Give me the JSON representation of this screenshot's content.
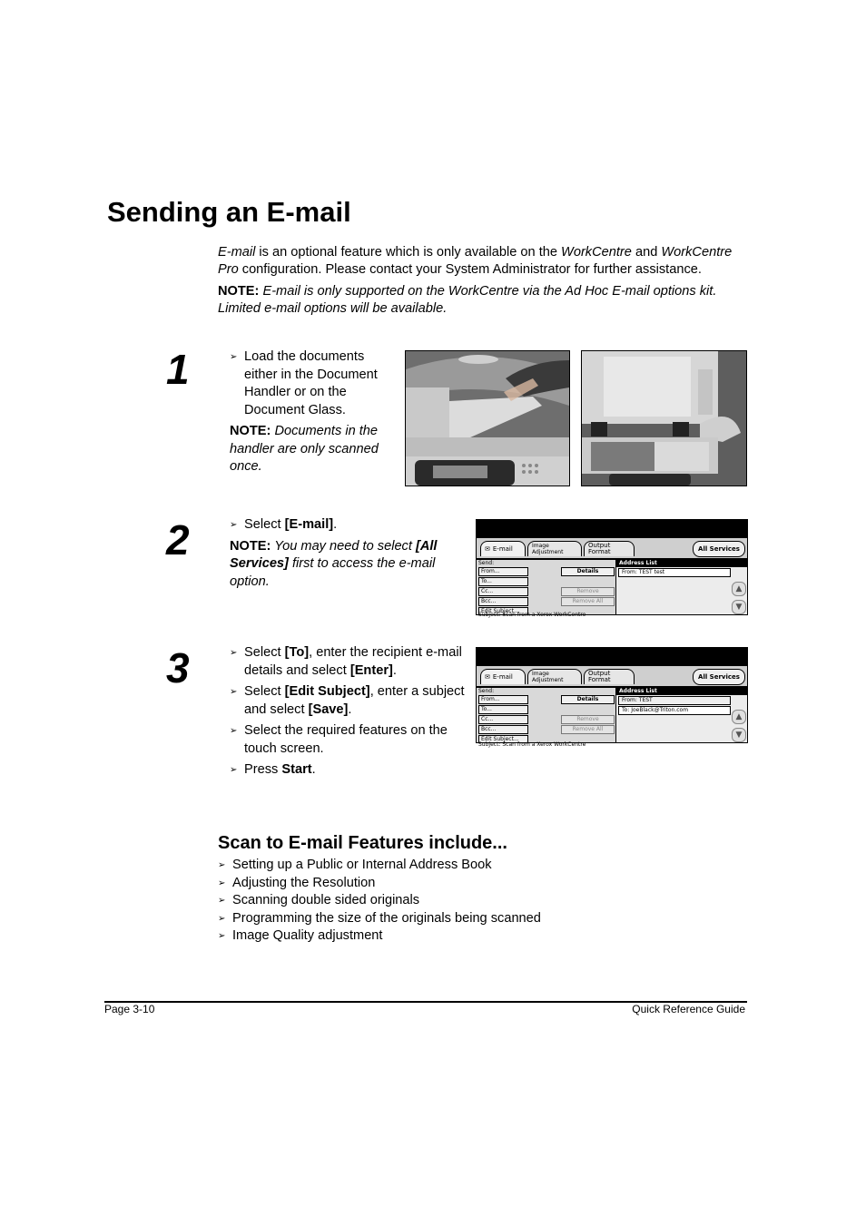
{
  "page_title": "Sending an E-mail",
  "intro": {
    "para1_em1": "E-mail",
    "para1_t1": " is an optional feature which is only available on the ",
    "para1_em2": "WorkCentre",
    "para1_t2": " and ",
    "para1_em3": "WorkCentre Pro",
    "para1_t3": " configuration. Please contact your System Administrator for further assistance.",
    "note_label": "NOTE:",
    "note_text": " E-mail is only supported on the WorkCentre via the Ad Hoc E-mail options kit. Limited e-mail options will be available."
  },
  "steps": [
    {
      "number": "1",
      "bullet": "Load the documents either in the Document Handler or on the Document Glass.",
      "note_label": "NOTE:",
      "note_text": " Documents in the handler are only scanned once.",
      "photos": [
        "document-handler-photo",
        "document-glass-photo"
      ]
    },
    {
      "number": "2",
      "bullet_pre": "Select ",
      "bullet_bold": "[E-mail]",
      "bullet_post": ".",
      "note_label": "NOTE:",
      "note_pre": " You may need to select ",
      "note_bold": "[All Services]",
      "note_post": " first to access the e-mail option."
    },
    {
      "number": "3",
      "bullets": [
        {
          "pre": "Select ",
          "bold": "[To]",
          "mid": ", enter the recipient e-mail details and select ",
          "bold2": "[Enter]",
          "post": "."
        },
        {
          "pre": "Select ",
          "bold": "[Edit Subject]",
          "mid": ", enter a subject and select ",
          "bold2": "[Save]",
          "post": "."
        },
        {
          "pre": "Select the required features on the touch screen.",
          "bold": "",
          "mid": "",
          "bold2": "",
          "post": ""
        },
        {
          "pre": "Press ",
          "bold": "Start",
          "mid": "",
          "bold2": "",
          "post": "."
        }
      ]
    }
  ],
  "touchscreen": {
    "tab_email": "E-mail",
    "tab_image_adjustment_l1": "Image",
    "tab_image_adjustment_l2": "Adjustment",
    "tab_output_format": "Output Format",
    "all_services": "All Services",
    "send_label": "Send:",
    "btn_from": "From...",
    "btn_to": "To...",
    "btn_cc": "Cc...",
    "btn_bcc": "Bcc...",
    "btn_edit_subject": "Edit Subject...",
    "btn_details": "Details",
    "btn_remove": "Remove",
    "btn_remove_all": "Remove All",
    "address_list": "Address List",
    "subject_line": "Subject:  Scan from a Xerox WorkCentre",
    "screen2_entries": [
      "From: TEST test"
    ],
    "screen3_entries": [
      "From: TEST",
      "To: JoeBlack@Triton.com"
    ]
  },
  "features": {
    "heading": "Scan to E-mail Features include...",
    "items": [
      "Setting up a Public or Internal Address Book",
      "Adjusting the Resolution",
      "Scanning double sided originals",
      "Programming the size of the originals being scanned",
      "Image Quality adjustment"
    ]
  },
  "footer": {
    "left": "Page 3-10",
    "right": "Quick Reference Guide"
  },
  "bullet_glyph": "➢",
  "icons": {
    "up": "▲",
    "down": "▼"
  }
}
